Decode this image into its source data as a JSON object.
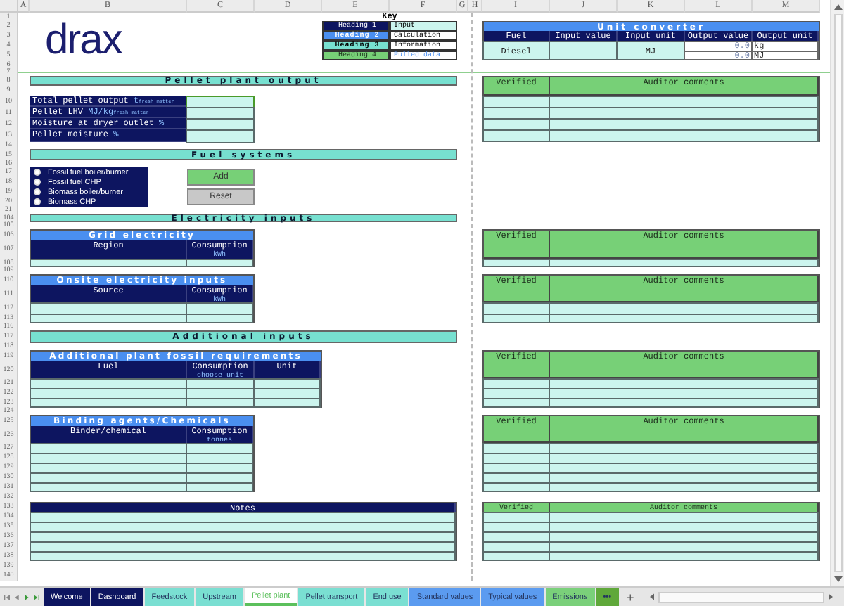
{
  "column_headers": [
    "A",
    "B",
    "C",
    "D",
    "E",
    "F",
    "G",
    "H",
    "I",
    "J",
    "K",
    "L",
    "M"
  ],
  "row_numbers": [
    "1",
    "2",
    "3",
    "4",
    "5",
    "6",
    "7",
    "8",
    "9",
    "10",
    "11",
    "12",
    "13",
    "14",
    "15",
    "16",
    "17",
    "18",
    "19",
    "20",
    "21",
    "104",
    "105",
    "106",
    "107",
    "108",
    "109",
    "110",
    "111",
    "112",
    "113",
    "116",
    "117",
    "118",
    "119",
    "120",
    "121",
    "122",
    "123",
    "124",
    "125",
    "126",
    "127",
    "128",
    "129",
    "130",
    "131",
    "132",
    "133",
    "134",
    "135",
    "136",
    "137",
    "138",
    "139",
    "140"
  ],
  "logo": "drax",
  "key": {
    "title": "Key",
    "headings": [
      {
        "label": "Heading 1",
        "kind": "heading1"
      },
      {
        "label": "Heading 2",
        "kind": "heading2"
      },
      {
        "label": "Heading 3",
        "kind": "heading3"
      },
      {
        "label": "Heading 4",
        "kind": "heading4"
      }
    ],
    "cell_styles": [
      {
        "label": "Input",
        "kind": "input"
      },
      {
        "label": "Calculation",
        "kind": "calculation"
      },
      {
        "label": "Information",
        "kind": "information"
      },
      {
        "label": "Pulled data",
        "kind": "pulled"
      }
    ]
  },
  "pellet_output": {
    "title": "Pellet plant output",
    "fields": [
      {
        "label": "Total pellet output",
        "unit": "t$_{fresh matter}$",
        "selected": true
      },
      {
        "label": "Pellet LHV",
        "unit": "MJ/kg$_{fresh matter}$",
        "selected": false
      },
      {
        "label": "Moisture at dryer outlet",
        "unit": "%",
        "selected": false
      },
      {
        "label": "Pellet moisture",
        "unit": "%",
        "selected": false
      }
    ]
  },
  "fuel_systems": {
    "title": "Fuel systems",
    "options": [
      {
        "label": "Fossil fuel boiler/burner",
        "selected": false
      },
      {
        "label": "Fossil fuel CHP",
        "selected": false
      },
      {
        "label": "Biomass boiler/burner",
        "selected": false
      },
      {
        "label": "Biomass CHP",
        "selected": false
      }
    ],
    "buttons": [
      {
        "label": "Add",
        "kind": "add"
      },
      {
        "label": "Reset",
        "kind": "reset"
      }
    ]
  },
  "electricity_inputs": {
    "title": "Electricity inputs",
    "tables": [
      {
        "title": "Grid electricity",
        "columns": [
          {
            "label": "Region"
          },
          {
            "label": "Consumption",
            "unit": "kWh"
          }
        ]
      },
      {
        "title": "Onsite electricity inputs",
        "columns": [
          {
            "label": "Source"
          },
          {
            "label": "Consumption",
            "unit": "kWh"
          }
        ]
      }
    ]
  },
  "additional_inputs": {
    "title": "Additional inputs",
    "tables": [
      {
        "title": "Additional plant fossil requirements",
        "columns": [
          {
            "label": "Fuel"
          },
          {
            "label": "Consumption",
            "unit": "choose unit"
          },
          {
            "label": "Unit"
          }
        ]
      },
      {
        "title": "Binding agents/Chemicals",
        "columns": [
          {
            "label": "Binder/chemical"
          },
          {
            "label": "Consumption",
            "unit": "tonnes"
          }
        ]
      }
    ]
  },
  "notes": {
    "title": "Notes"
  },
  "unit_converter": {
    "title": "Unit converter",
    "columns": [
      "Fuel",
      "Input value",
      "Input unit",
      "Output value",
      "Output unit"
    ],
    "fuel": "Diesel",
    "input_unit": "MJ",
    "outputs": [
      {
        "value": "0.0",
        "unit": "kg"
      },
      {
        "value": "0.0",
        "unit": "MJ"
      }
    ]
  },
  "audit_tables": [
    {
      "columns": [
        "Verified",
        "Auditor comments"
      ]
    },
    {
      "columns": [
        "Verified",
        "Auditor comments"
      ]
    },
    {
      "columns": [
        "Verified",
        "Auditor comments"
      ]
    },
    {
      "columns": [
        "Verified",
        "Auditor comments"
      ]
    },
    {
      "columns": [
        "Verified",
        "Auditor comments"
      ]
    },
    {
      "columns": [
        "Verified",
        "Auditor comments"
      ]
    }
  ],
  "sheet_tabs": [
    {
      "label": "Welcome",
      "color": "#0d1560",
      "selected": false
    },
    {
      "label": "Dashboard",
      "color": "#0d1560",
      "selected": false
    },
    {
      "label": "Feedstock",
      "color": "#7adfd2",
      "selected": false
    },
    {
      "label": "Upstream",
      "color": "#7adfd2",
      "selected": false
    },
    {
      "label": "Pellet plant",
      "color": "#5cc05c",
      "selected": true
    },
    {
      "label": "Pellet transport",
      "color": "#7adfd2",
      "selected": false
    },
    {
      "label": "End use",
      "color": "#7adfd2",
      "selected": false
    },
    {
      "label": "Standard values",
      "color": "#5b9bf0",
      "selected": false
    },
    {
      "label": "Typical values",
      "color": "#5b9bf0",
      "selected": false
    },
    {
      "label": "Emissions",
      "color": "#7ad07a",
      "selected": false
    },
    {
      "label": "•••",
      "color": "#5fa83a",
      "selected": false
    }
  ],
  "add_sheet": "+"
}
